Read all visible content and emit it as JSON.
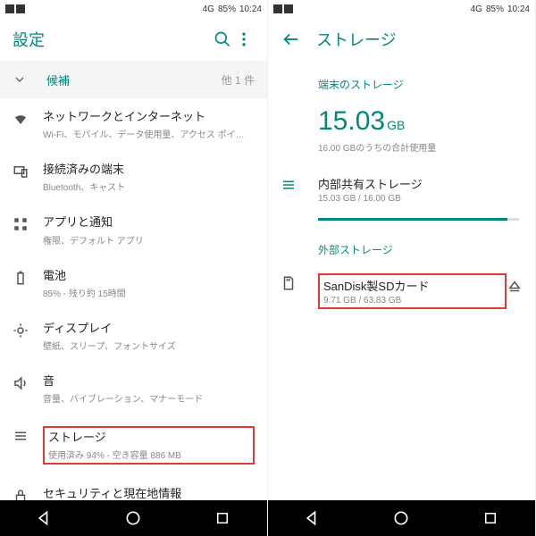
{
  "status": {
    "battery": "85%",
    "time": "10:24",
    "net": "4G"
  },
  "left": {
    "title": "設定",
    "suggestion": {
      "label": "候補",
      "more": "他 1 件"
    },
    "items": [
      {
        "title": "ネットワークとインターネット",
        "sub": "Wi-Fi、モバイル、データ使用量、アクセス ポイ…"
      },
      {
        "title": "接続済みの端末",
        "sub": "Bluetooth、キャスト"
      },
      {
        "title": "アプリと通知",
        "sub": "権限、デフォルト アプリ"
      },
      {
        "title": "電池",
        "sub": "85% - 残り約 15時間"
      },
      {
        "title": "ディスプレイ",
        "sub": "壁紙、スリープ、フォントサイズ"
      },
      {
        "title": "音",
        "sub": "音量、バイブレーション、マナーモード"
      },
      {
        "title": "ストレージ",
        "sub": "使用済み 94% - 空き容量 886 MB"
      },
      {
        "title": "セキュリティと現在地情報",
        "sub": ""
      }
    ]
  },
  "right": {
    "title": "ストレージ",
    "sections": {
      "device": "端末のストレージ",
      "external": "外部ストレージ"
    },
    "total": {
      "num": "15.03",
      "unit": "GB",
      "sub": "16.00 GBのうちの合計使用量"
    },
    "internal": {
      "title": "内部共有ストレージ",
      "sub": "15.03 GB / 16.00 GB"
    },
    "sd": {
      "title": "SanDisk製SDカード",
      "sub": "9.71 GB / 63.83 GB"
    }
  }
}
